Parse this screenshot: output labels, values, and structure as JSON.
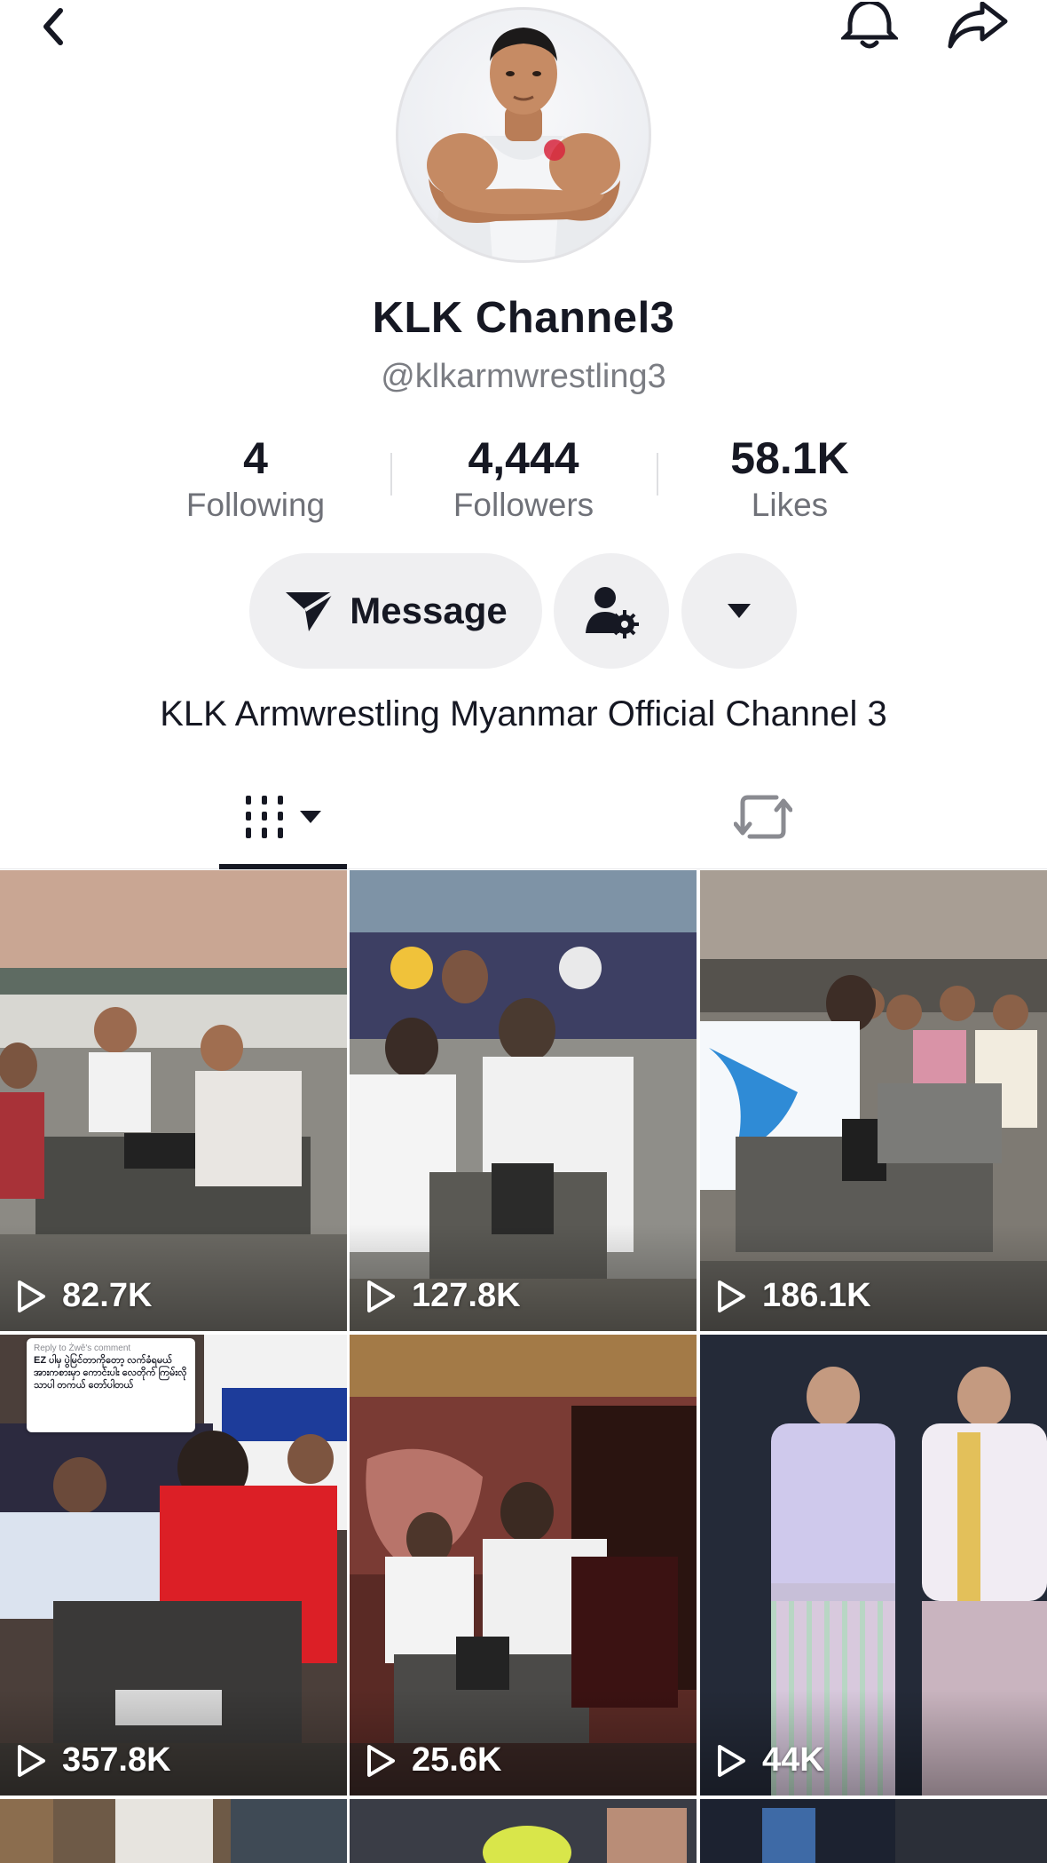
{
  "header": {
    "back_icon": "chevron-left-icon",
    "bell_icon": "bell-icon",
    "share_icon": "share-arrow-icon"
  },
  "profile": {
    "name": "KLK Channel3",
    "handle": "@klkarmwrestling3",
    "bio": "KLK Armwrestling Myanmar Official Channel 3"
  },
  "stats": [
    {
      "value": "4",
      "label": "Following"
    },
    {
      "value": "4,444",
      "label": "Followers"
    },
    {
      "value": "58.1K",
      "label": "Likes"
    }
  ],
  "actions": {
    "message_label": "Message",
    "message_icon": "send-icon",
    "friends_icon": "user-gear-icon",
    "more_icon": "caret-down-icon"
  },
  "tabs": [
    {
      "name": "videos",
      "icon": "grid-bars-icon",
      "active": true
    },
    {
      "name": "reposts",
      "icon": "repost-icon",
      "active": false
    }
  ],
  "videos": [
    {
      "views": "82.7K"
    },
    {
      "views": "127.8K"
    },
    {
      "views": "186.1K"
    },
    {
      "views": "357.8K",
      "caption_header": "Reply to Żwê's comment",
      "caption_text": "EZ ပါမှ ပွဲမြင်တာကိုတော့ လက်ခံရမယ် အားကစားမှာ ကောင်းပါး လေတိုက် ကြမ်းလိုသာပါ တကယ် တော်ပါတယ်"
    },
    {
      "views": "25.6K"
    },
    {
      "views": "44K"
    }
  ],
  "colors": {
    "text_primary": "#161823",
    "text_secondary": "#7b7d83",
    "pill_bg": "#efeff1"
  }
}
